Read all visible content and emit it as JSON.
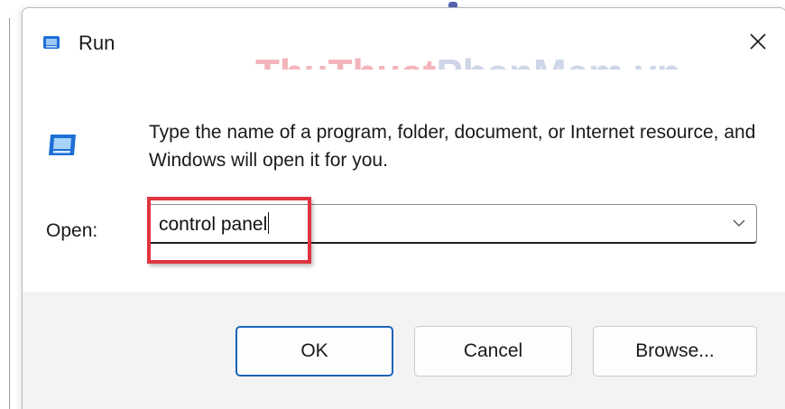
{
  "window": {
    "title": "Run",
    "title_icon": "run-app-icon",
    "close_icon": "close-icon"
  },
  "watermark": {
    "part1": "ThuThuat",
    "part2": "PhanMem.vn"
  },
  "content": {
    "icon": "run-app-icon",
    "description": "Type the name of a program, folder, document, or Internet resource, and Windows will open it for you."
  },
  "open_field": {
    "label": "Open:",
    "value": "control panel",
    "dropdown_icon": "chevron-down-icon"
  },
  "buttons": {
    "ok": "OK",
    "cancel": "Cancel",
    "browse": "Browse..."
  },
  "colors": {
    "highlight": "#e0343f",
    "accent": "#1c63b7",
    "icon_blue": "#1e6fd6",
    "footer_bg": "#f3f3f3"
  }
}
